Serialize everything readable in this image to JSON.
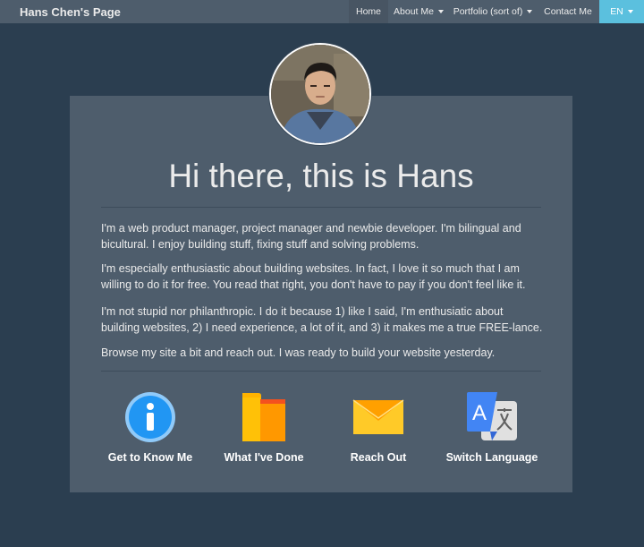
{
  "navbar": {
    "brand": "Hans Chen's Page",
    "items": [
      {
        "label": "Home",
        "active": true,
        "dropdown": false
      },
      {
        "label": "About Me",
        "active": false,
        "dropdown": true
      },
      {
        "label": "Portfolio (sort of)",
        "active": false,
        "dropdown": true
      },
      {
        "label": "Contact Me",
        "active": false,
        "dropdown": false
      }
    ],
    "language": "EN"
  },
  "hero": {
    "title": "Hi there, this is Hans",
    "paragraphs": [
      "I'm a web product manager, project manager and newbie developer. I'm bilingual and bicultural. I enjoy building stuff, fixing stuff and solving problems.",
      "I'm especially enthusiastic about building websites. In fact, I love it so much that I am willing to do it for free. You read that right, you don't have to pay if you don't feel like it.",
      "I'm not stupid nor philanthropic. I do it because 1) like I said, I'm enthusiatic about building websites, 2) I need experience, a lot of it, and 3) it makes me a true FREE-lance.",
      "Browse my site a bit and reach out. I was ready to build your website yesterday."
    ]
  },
  "links": [
    {
      "label": "Get to Know Me",
      "icon": "info-icon"
    },
    {
      "label": "What I've Done",
      "icon": "folder-icon"
    },
    {
      "label": "Reach Out",
      "icon": "envelope-icon"
    },
    {
      "label": "Switch Language",
      "icon": "translate-icon"
    }
  ],
  "colors": {
    "background": "#2b3e50",
    "navbar": "#4e5d6c",
    "card": "#4e5d6c",
    "lang_button": "#5bc0de",
    "info_icon": "#2196f3",
    "folder_icon": "#ffb300",
    "envelope_icon": "#ffca28",
    "translate_icon": "#4285f4"
  }
}
